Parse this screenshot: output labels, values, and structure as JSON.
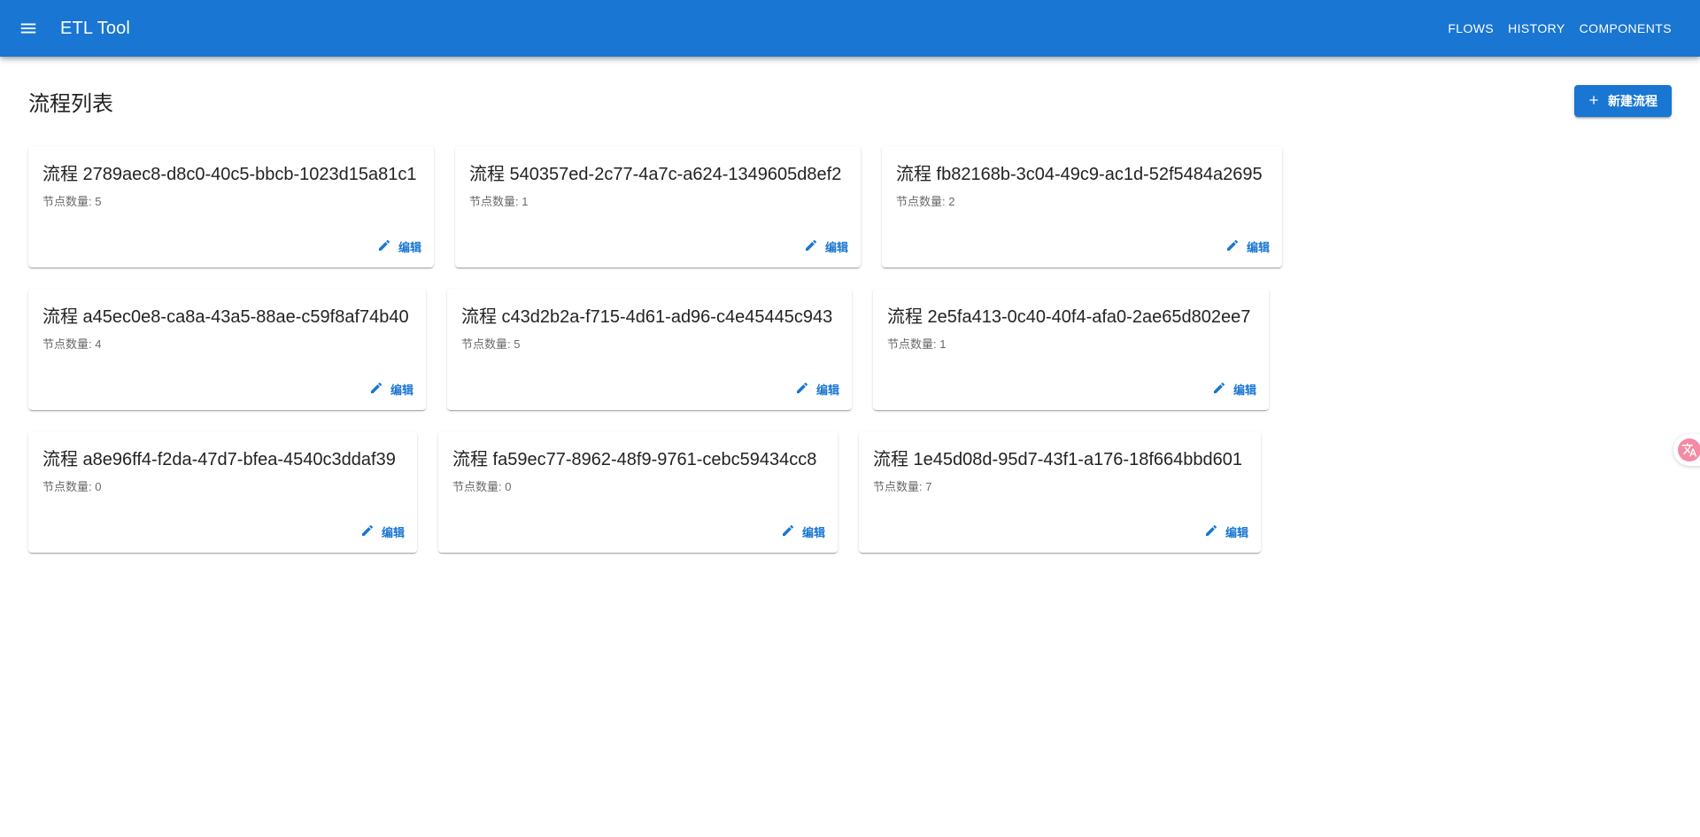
{
  "app": {
    "title": "ETL Tool",
    "menu_icon": "menu-icon",
    "nav": [
      "FLOWS",
      "HISTORY",
      "COMPONENTS"
    ]
  },
  "page": {
    "title": "流程列表",
    "new_button": "新建流程",
    "new_icon": "plus-icon"
  },
  "cards": [
    {
      "title": "流程 2789aec8-d8c0-40c5-bbcb-1023d15a81c1",
      "nodes": "节点数量: 5",
      "edit": "编辑"
    },
    {
      "title": "流程 540357ed-2c77-4a7c-a624-1349605d8ef2",
      "nodes": "节点数量: 1",
      "edit": "编辑"
    },
    {
      "title": "流程 fb82168b-3c04-49c9-ac1d-52f5484a2695",
      "nodes": "节点数量: 2",
      "edit": "编辑"
    },
    {
      "title": "流程 a45ec0e8-ca8a-43a5-88ae-c59f8af74b40",
      "nodes": "节点数量: 4",
      "edit": "编辑"
    },
    {
      "title": "流程 c43d2b2a-f715-4d61-ad96-c4e45445c943",
      "nodes": "节点数量: 5",
      "edit": "编辑"
    },
    {
      "title": "流程 2e5fa413-0c40-40f4-afa0-2ae65d802ee7",
      "nodes": "节点数量: 1",
      "edit": "编辑"
    },
    {
      "title": "流程 a8e96ff4-f2da-47d7-bfea-4540c3ddaf39",
      "nodes": "节点数量: 0",
      "edit": "编辑"
    },
    {
      "title": "流程 fa59ec77-8962-48f9-9761-cebc59434cc8",
      "nodes": "节点数量: 0",
      "edit": "编辑"
    },
    {
      "title": "流程 1e45d08d-95d7-43f1-a176-18f664bbd601",
      "nodes": "节点数量: 7",
      "edit": "编辑"
    }
  ],
  "colors": {
    "primary": "#1976d2",
    "translate_badge": "#f28ba3"
  },
  "translate_widget_icon": "translate-icon"
}
